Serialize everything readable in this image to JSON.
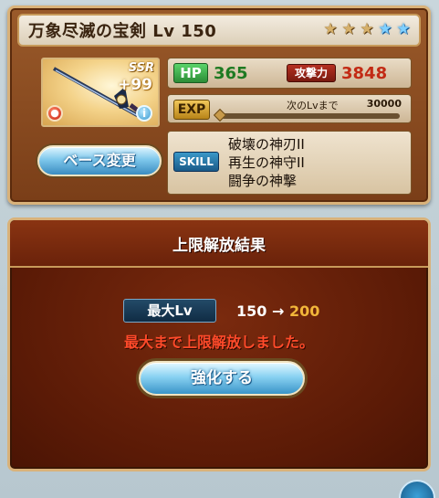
{
  "weapon": {
    "name": "万象尽滅の宝剣 Lv 150",
    "rarity_badge": "SSR",
    "plus": "+99",
    "stars": [
      "gold",
      "gold",
      "gold",
      "blue",
      "blue"
    ],
    "hp_label": "HP",
    "hp_value": "365",
    "atk_label": "攻撃力",
    "atk_value": "3848",
    "exp_label": "EXP",
    "exp_next_label": "次のLvまで",
    "exp_next_value": "30000",
    "exp_progress": 0.0,
    "base_change_button": "ベース変更",
    "skill_label": "SKILL",
    "skills": [
      "破壊の神刃II",
      "再生の神守II",
      "闘争の神撃"
    ]
  },
  "result": {
    "title": "上限解放結果",
    "max_lv_label": "最大Lv",
    "lv_from": "150",
    "arrow": "→",
    "lv_to": "200",
    "message": "最大まで上限解放しました。",
    "enhance_button": "強化する"
  },
  "colors": {
    "hp": "#1e7a22",
    "atk": "#c22a14",
    "lv_new": "#f2b63a",
    "message": "#ff4a2a"
  }
}
